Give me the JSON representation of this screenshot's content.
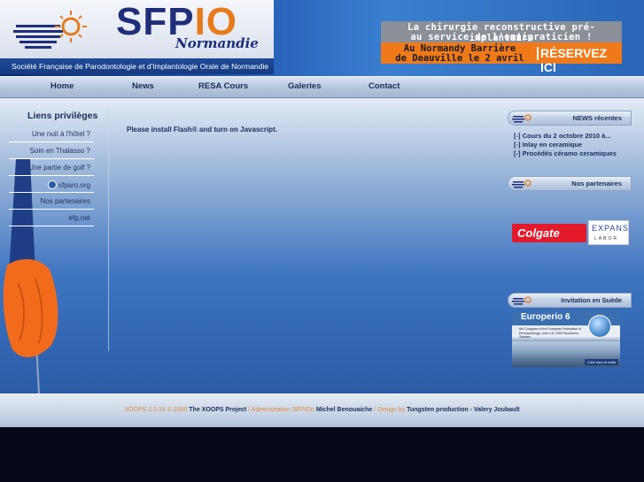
{
  "header": {
    "logo_sfp": "SFP",
    "logo_io": "IO",
    "logo_region": "Normandie",
    "logo_subtitle": "Société Française de Parodontologie et d'Implantologie Orale de Normandie",
    "promo": {
      "line1": "La chirurgie reconstructive pré-implantaire",
      "line2": "au service de l'omnipraticien !",
      "line3": "Au Normandy Barrière",
      "line4": "de Deauville le 2 avril",
      "cta": "RÉSERVEZ ICI"
    }
  },
  "nav": {
    "items": [
      "Home",
      "News",
      "RESA Cours",
      "Galeries",
      "Contact"
    ]
  },
  "sidebar_left": {
    "title": "Liens privilèges",
    "links": [
      "Une nuit à l'hôtel ?",
      "Soin en Thalasso ?",
      "Une partie de golf ?",
      "sfparo.org",
      "Nos partenaires",
      "efp.net"
    ]
  },
  "main": {
    "flash_message": "Please install Flash® and turn on Javascript."
  },
  "sidebar_right": {
    "news_title": "NEWS récentes",
    "news_items": [
      "[-] Cours du 2 octobre 2010 à...",
      "[-] Inlay en ceramique",
      "[-] Procédés céramo ceramiques"
    ],
    "partners_title": "Nos partenaires",
    "partner_colgate": "Colgate",
    "partner_expans": "EXPANS",
    "partner_expans_sub": "LABOR",
    "invitation_title": "Invitation en Suède",
    "europerio_title": "Europerio 6",
    "europerio_text": "6th Congress of the European Federation of Periodontology June 4-6, 2009 Stockholm, Sweden",
    "europerio_button": "Click here to enter"
  },
  "footer": {
    "part1": "XOOPS 2.0.18 © 2009 ",
    "part2": "The XOOPS Project",
    "part3": " / Administration SFPIOn ",
    "part4": "Michel Benouaiche",
    "part5": " / Design by ",
    "part6": "Tungsten production - Valery Joubault"
  },
  "colors": {
    "brand_blue": "#1e2e7a",
    "brand_orange": "#e77a1a",
    "promo_orange": "#f07a1a",
    "colgate_red": "#e21a2c"
  }
}
